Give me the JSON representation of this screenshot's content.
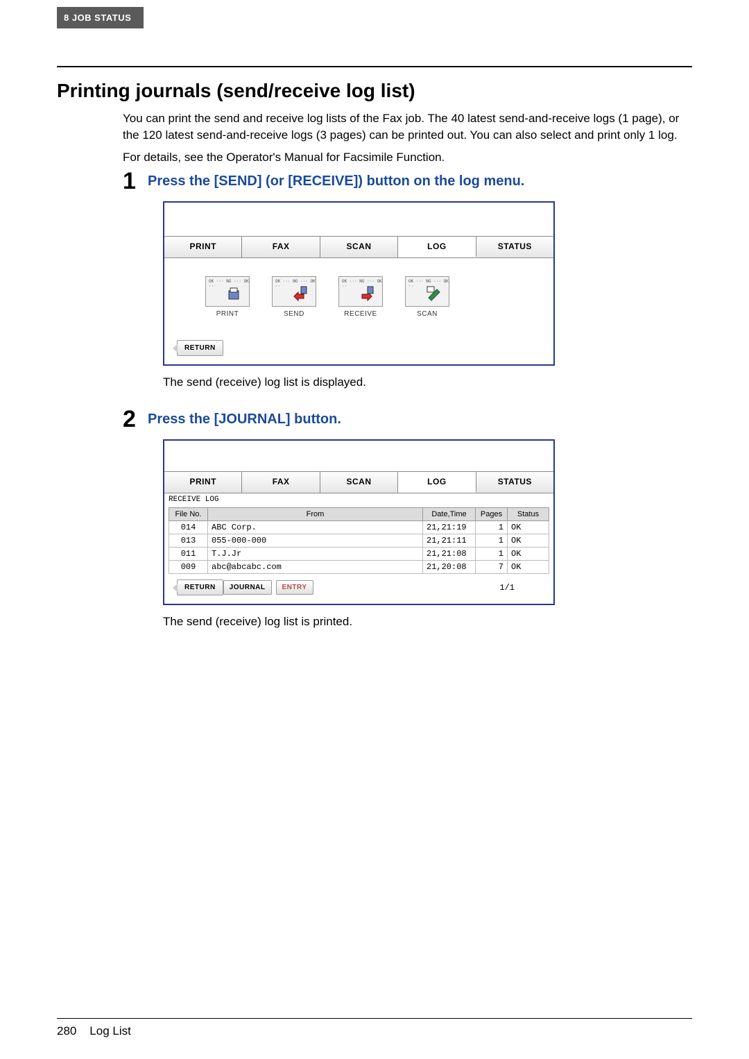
{
  "header_tab": "8   JOB STATUS",
  "heading": "Printing journals (send/receive log list)",
  "intro_p1": "You can print the send and receive log lists of the Fax job. The 40 latest send-and-receive logs (1 page), or the 120 latest send-and-receive logs (3 pages) can be printed out. You can also select and print only 1 log.",
  "intro_p2": "For details, see the Operator's Manual for Facsimile Function.",
  "step1": {
    "num": "1",
    "text": "Press the [SEND] (or [RECEIVE]) button on the log menu."
  },
  "step2": {
    "num": "2",
    "text": "Press the [JOURNAL] button."
  },
  "tabs": {
    "print": "PRINT",
    "fax": "FAX",
    "scan": "SCAN",
    "log": "LOG",
    "status": "STATUS"
  },
  "icons": {
    "print": "PRINT",
    "send": "SEND",
    "receive": "RECEIVE",
    "scan": "SCAN"
  },
  "icon_mini": "OK ···\nNG ···\nOK ··",
  "return_btn": "RETURN",
  "caption1": "The send (receive) log list is displayed.",
  "receive_log_label": "RECEIVE LOG",
  "table_headers": {
    "fileno": "File No.",
    "from": "From",
    "datetime": "Date,Time",
    "pages": "Pages",
    "status": "Status"
  },
  "rows": [
    {
      "fileno": "014",
      "from": "ABC Corp.",
      "datetime": "21,21:19",
      "pages": "1",
      "status": "OK"
    },
    {
      "fileno": "013",
      "from": "055-000-000",
      "datetime": "21,21:11",
      "pages": "1",
      "status": "OK"
    },
    {
      "fileno": "011",
      "from": "T.J.Jr",
      "datetime": "21,21:08",
      "pages": "1",
      "status": "OK"
    },
    {
      "fileno": "009",
      "from": "abc@abcabc.com",
      "datetime": "21,20:08",
      "pages": "7",
      "status": "OK"
    }
  ],
  "journal_btn": "JOURNAL",
  "entry_btn": "ENTRY",
  "pager": "1/1",
  "caption2": "The send (receive) log list is printed.",
  "footer": {
    "page": "280",
    "section": "Log List"
  }
}
